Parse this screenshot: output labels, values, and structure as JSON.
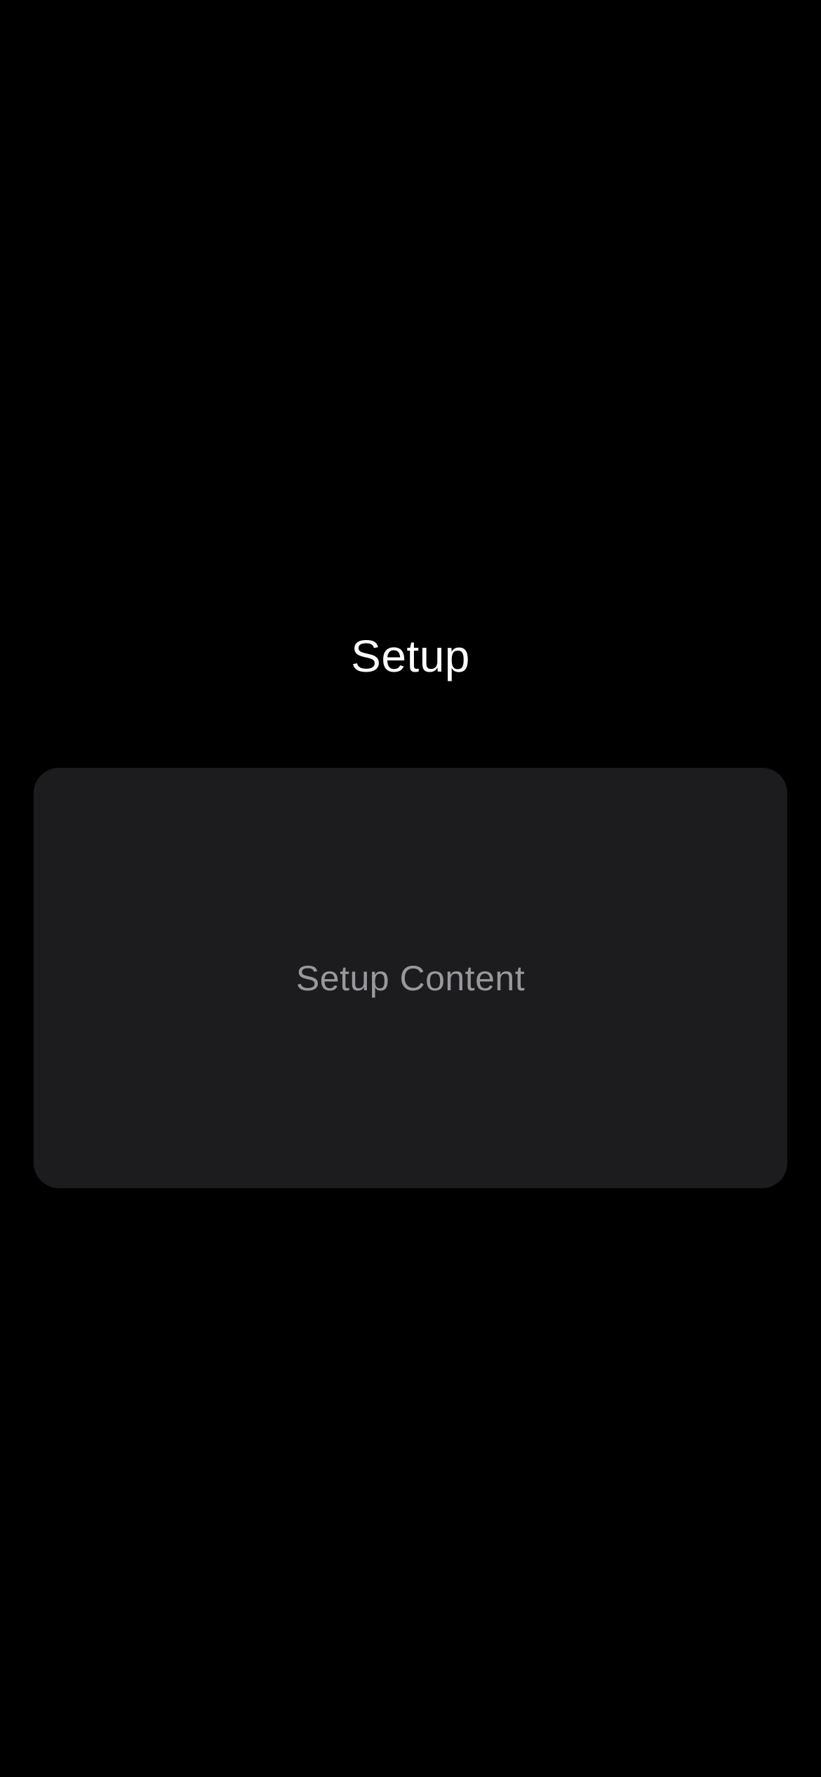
{
  "screen": {
    "title": "Setup",
    "card": {
      "label": "Setup Content"
    }
  },
  "colors": {
    "background": "#000000",
    "card_background": "#1c1c1e",
    "title_text": "#ffffff",
    "card_text": "#98989d"
  }
}
